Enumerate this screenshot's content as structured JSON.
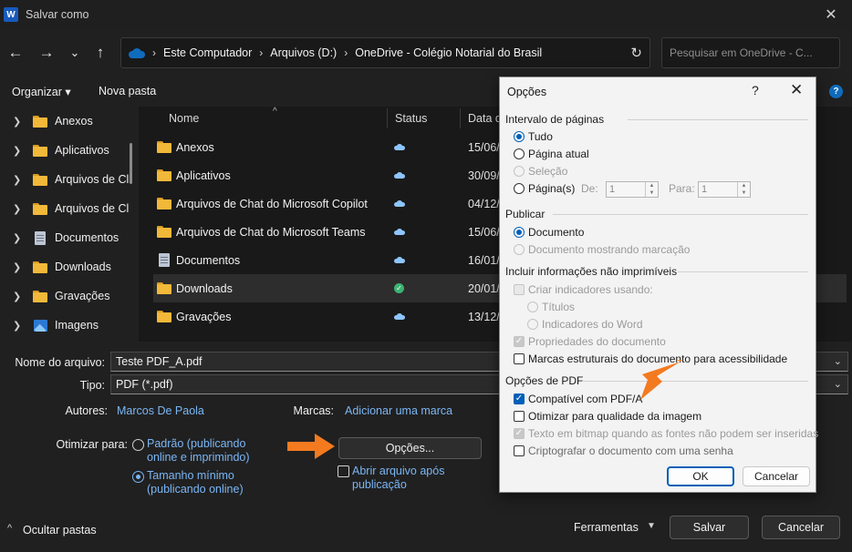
{
  "window": {
    "title": "Salvar como",
    "app_icon": "W"
  },
  "nav": {
    "back": "←",
    "forward": "→",
    "recent": "⌄",
    "up": "↑",
    "breadcrumb": [
      "Este Computador",
      "Arquivos (D:)",
      "OneDrive - Colégio Notarial do Brasil"
    ],
    "separator": "›",
    "refresh": "↻",
    "search_placeholder": "Pesquisar em OneDrive - C..."
  },
  "toolbar": {
    "organize": "Organizar ▾",
    "new_folder": "Nova pasta",
    "help": "?"
  },
  "sidebar": {
    "items": [
      {
        "label": "Anexos",
        "icon": "folder-icon"
      },
      {
        "label": "Aplicativos",
        "icon": "folder-icon"
      },
      {
        "label": "Arquivos de Cl",
        "icon": "folder-icon"
      },
      {
        "label": "Arquivos de Cl",
        "icon": "folder-icon"
      },
      {
        "label": "Documentos",
        "icon": "document-icon"
      },
      {
        "label": "Downloads",
        "icon": "folder-icon"
      },
      {
        "label": "Gravações",
        "icon": "folder-icon"
      },
      {
        "label": "Imagens",
        "icon": "image-icon"
      }
    ]
  },
  "filelist": {
    "columns": {
      "name": "Nome",
      "status": "Status",
      "date": "Data d"
    },
    "rows": [
      {
        "name": "Anexos",
        "status": "cloud",
        "date": "15/06/",
        "icon": "folder-icon"
      },
      {
        "name": "Aplicativos",
        "status": "cloud",
        "date": "30/09/",
        "icon": "folder-icon"
      },
      {
        "name": "Arquivos de Chat do Microsoft Copilot",
        "status": "cloud",
        "date": "04/12/",
        "icon": "folder-icon"
      },
      {
        "name": "Arquivos de Chat do Microsoft Teams",
        "status": "cloud",
        "date": "15/06/",
        "icon": "folder-icon"
      },
      {
        "name": "Documentos",
        "status": "cloud",
        "date": "16/01/",
        "icon": "document-icon"
      },
      {
        "name": "Downloads",
        "status": "synced",
        "date": "20/01/",
        "icon": "folder-icon"
      },
      {
        "name": "Gravações",
        "status": "cloud",
        "date": "13/12/",
        "icon": "folder-icon"
      }
    ]
  },
  "form": {
    "filename_label": "Nome do arquivo:",
    "filename_value": "Teste PDF_A.pdf",
    "type_label": "Tipo:",
    "type_value": "PDF (*.pdf)",
    "authors_label": "Autores:",
    "authors_value": "Marcos De Paola",
    "tags_label": "Marcas:",
    "tags_value": "Adicionar uma marca",
    "optimize_label": "Otimizar para:",
    "optimize_standard": "Padrão (publicando online e imprimindo)",
    "optimize_standard_l1": "Padrão (publicando",
    "optimize_standard_l2": "online e imprimindo)",
    "optimize_min_l1": "Tamanho mínimo",
    "optimize_min_l2": "(publicando online)",
    "options_button": "Opções...",
    "open_after_l1": "Abrir arquivo após",
    "open_after_l2": "publicação",
    "hide_folders": "Ocultar pastas",
    "tools": "Ferramentas",
    "save": "Salvar",
    "cancel": "Cancelar"
  },
  "dialog": {
    "title": "Opções",
    "help": "?",
    "close": "✕",
    "range_section": "Intervalo de páginas",
    "range_all": "Tudo",
    "range_current": "Página atual",
    "range_selection": "Seleção",
    "range_pages": "Página(s)",
    "from_label": "De:",
    "from_value": "1",
    "to_label": "Para:",
    "to_value": "1",
    "publish_section": "Publicar",
    "publish_document": "Documento",
    "publish_markup": "Documento mostrando marcação",
    "nonprint_section": "Incluir informações não imprimíveis",
    "create_bookmarks": "Criar indicadores usando:",
    "bookmarks_headings": "Títulos",
    "bookmarks_word": "Indicadores do Word",
    "doc_properties": "Propriedades do documento",
    "structure_tags": "Marcas estruturais do documento para acessibilidade",
    "pdf_section": "Opções de PDF",
    "pdfa": "Compatível com PDF/A",
    "optimize_image": "Otimizar para qualidade da imagem",
    "bitmap_text": "Texto em bitmap quando as fontes não podem ser inseridas",
    "encrypt": "Criptografar o documento com uma senha",
    "ok": "OK",
    "cancel": "Cancelar"
  },
  "colors": {
    "accent": "#0f6cbd",
    "link": "#7ab6f5",
    "arrow": "#f47a20",
    "dialog_accent": "#005fb8"
  }
}
